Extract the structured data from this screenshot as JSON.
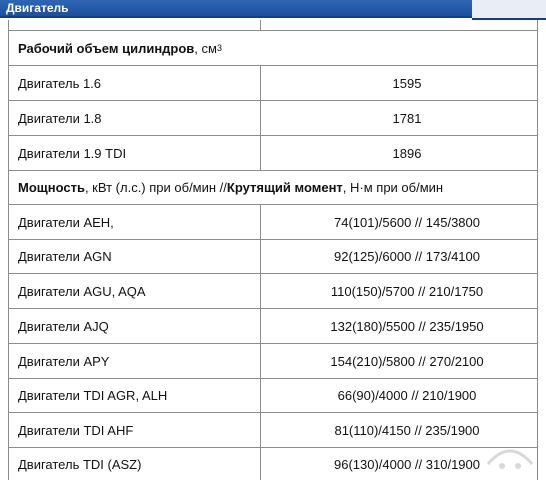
{
  "window": {
    "title": "Двигатель"
  },
  "volume_section": {
    "header_bold": "Рабочий объем цилиндров",
    "header_unit": ", см",
    "header_sup": "3",
    "rows": [
      {
        "name": "Двигатель 1.6",
        "value": "1595"
      },
      {
        "name": "Двигатели 1.8",
        "value": "1781"
      },
      {
        "name": "Двигатели 1.9 TDI",
        "value": "1896"
      }
    ]
  },
  "power_section": {
    "header_bold1": "Мощность",
    "header_text1": ", кВт (л.с.) при об/мин // ",
    "header_bold2": "Крутящий момент",
    "header_text2": ", Н·м при об/мин",
    "rows": [
      {
        "name": "Двигатели AEH,",
        "value": "74(101)/5600 // 145/3800"
      },
      {
        "name": "Двигатели AGN",
        "value": "92(125)/6000 // 173/4100"
      },
      {
        "name": "Двигатели AGU, AQA",
        "value": "110(150)/5700 // 210/1750"
      },
      {
        "name": "Двигатели AJQ",
        "value": "132(180)/5500 // 235/1950"
      },
      {
        "name": "Двигатели APY",
        "value": "154(210)/5800 // 270/2100"
      },
      {
        "name": "Двигатели TDI AGR, ALH",
        "value": "66(90)/4000 // 210/1900"
      },
      {
        "name": "Двигатели TDI AHF",
        "value": "81(110)/4150 // 235/1900"
      },
      {
        "name": "Двигатель TDI (ASZ)",
        "value": "96(130)/4000 // 310/1900"
      }
    ]
  },
  "colors": {
    "title_bar": "#2f66b4",
    "border": "#8c8c8c"
  }
}
